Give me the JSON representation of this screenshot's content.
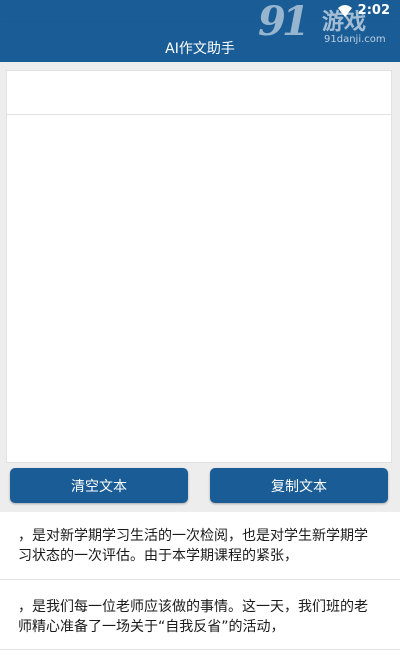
{
  "status_bar": {
    "time": "2:02",
    "icons": [
      "wifi-icon"
    ]
  },
  "app_bar": {
    "title": "AI作文助手"
  },
  "watermark": {
    "number": "91",
    "brand": "游戏",
    "url": "91danji.com"
  },
  "editor": {
    "title_value": "",
    "body_value": ""
  },
  "buttons": {
    "clear_label": "清空文本",
    "copy_label": "复制文本"
  },
  "results": [
    {
      "text": "，是对新学期学习生活的一次检阅，也是对学生新学期学习状态的一次评估。由于本学期课程的紧张，"
    },
    {
      "text": "，是我们每一位老师应该做的事情。这一天，我们班的老师精心准备了一场关于“自我反省”的活动，"
    }
  ],
  "colors": {
    "primary": "#1a5c95",
    "background": "#ededed"
  }
}
